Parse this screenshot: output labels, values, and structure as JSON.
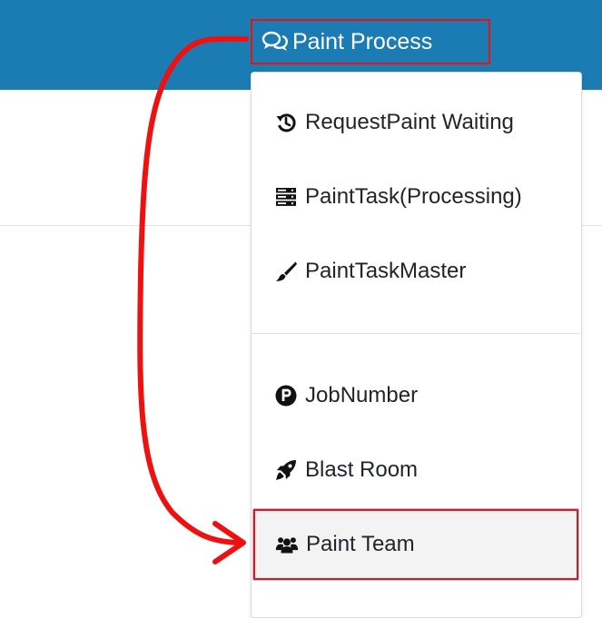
{
  "navbar": {
    "menu": {
      "label": "Paint Process",
      "icon": "comments-icon"
    }
  },
  "dropdown": {
    "items": [
      {
        "label": "RequestPaint Waiting",
        "icon": "history-icon"
      },
      {
        "label": "PaintTask(Processing)",
        "icon": "server-icon"
      },
      {
        "label": "PaintTaskMaster",
        "icon": "paint-brush-icon"
      },
      {
        "label": "JobNumber",
        "icon": "parking-icon"
      },
      {
        "label": "Blast Room",
        "icon": "rocket-icon"
      },
      {
        "label": "Paint Team",
        "icon": "users-icon",
        "active": true
      }
    ]
  },
  "colors": {
    "navbar_bg": "#1b7cb3",
    "highlight": "#ee1111",
    "menu_text": "#212529"
  }
}
